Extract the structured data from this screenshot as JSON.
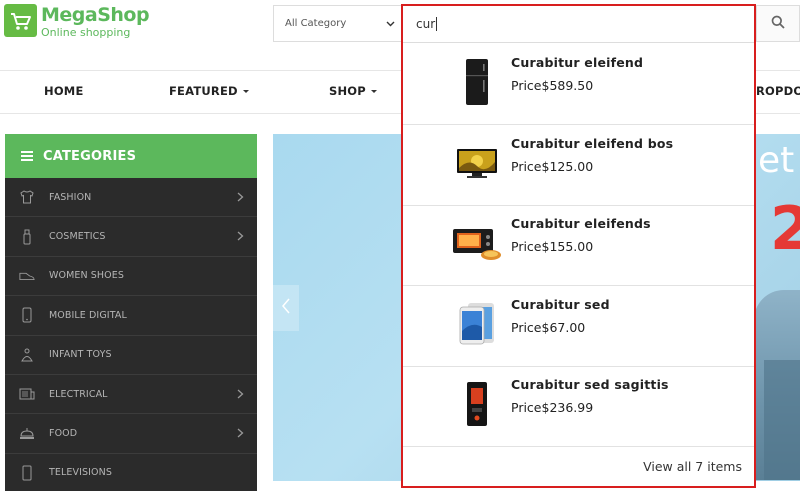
{
  "brand": {
    "name": "MegaShop",
    "tagline": "Online shopping",
    "accent": "#5cb85c"
  },
  "search": {
    "category": "All Category",
    "query": "cur",
    "results": [
      {
        "name": "Curabitur eleifend",
        "price": "Price$589.50",
        "icon": "refrigerator-icon"
      },
      {
        "name": "Curabitur eleifend bos",
        "price": "Price$125.00",
        "icon": "television-icon"
      },
      {
        "name": "Curabitur eleifends",
        "price": "Price$155.00",
        "icon": "toaster-oven-icon"
      },
      {
        "name": "Curabitur sed",
        "price": "Price$67.00",
        "icon": "tablet-icon"
      },
      {
        "name": "Curabitur sed sagittis",
        "price": "Price$236.99",
        "icon": "computer-case-icon"
      }
    ],
    "view_all": "View all 7 items",
    "highlight_color": "#d81e1e"
  },
  "nav": {
    "items": [
      {
        "label": "HOME"
      },
      {
        "label": "FEATURED"
      },
      {
        "label": "SHOP"
      },
      {
        "label": "ROPDO"
      }
    ]
  },
  "categories": {
    "title": "CATEGORIES",
    "items": [
      {
        "label": "FASHION",
        "icon": "shirt-icon",
        "has_sub": true
      },
      {
        "label": "COSMETICS",
        "icon": "bottle-icon",
        "has_sub": true
      },
      {
        "label": "WOMEN SHOES",
        "icon": "shoe-icon",
        "has_sub": false
      },
      {
        "label": "MOBILE DIGITAL",
        "icon": "phone-icon",
        "has_sub": false
      },
      {
        "label": "INFANT TOYS",
        "icon": "toy-icon",
        "has_sub": false
      },
      {
        "label": "ELECTRICAL",
        "icon": "appliance-icon",
        "has_sub": true
      },
      {
        "label": "FOOD",
        "icon": "food-icon",
        "has_sub": true
      },
      {
        "label": "TELEVISIONS",
        "icon": "tv-icon",
        "has_sub": false
      }
    ]
  },
  "banner": {
    "text_top": "et in",
    "text_big": "2"
  }
}
